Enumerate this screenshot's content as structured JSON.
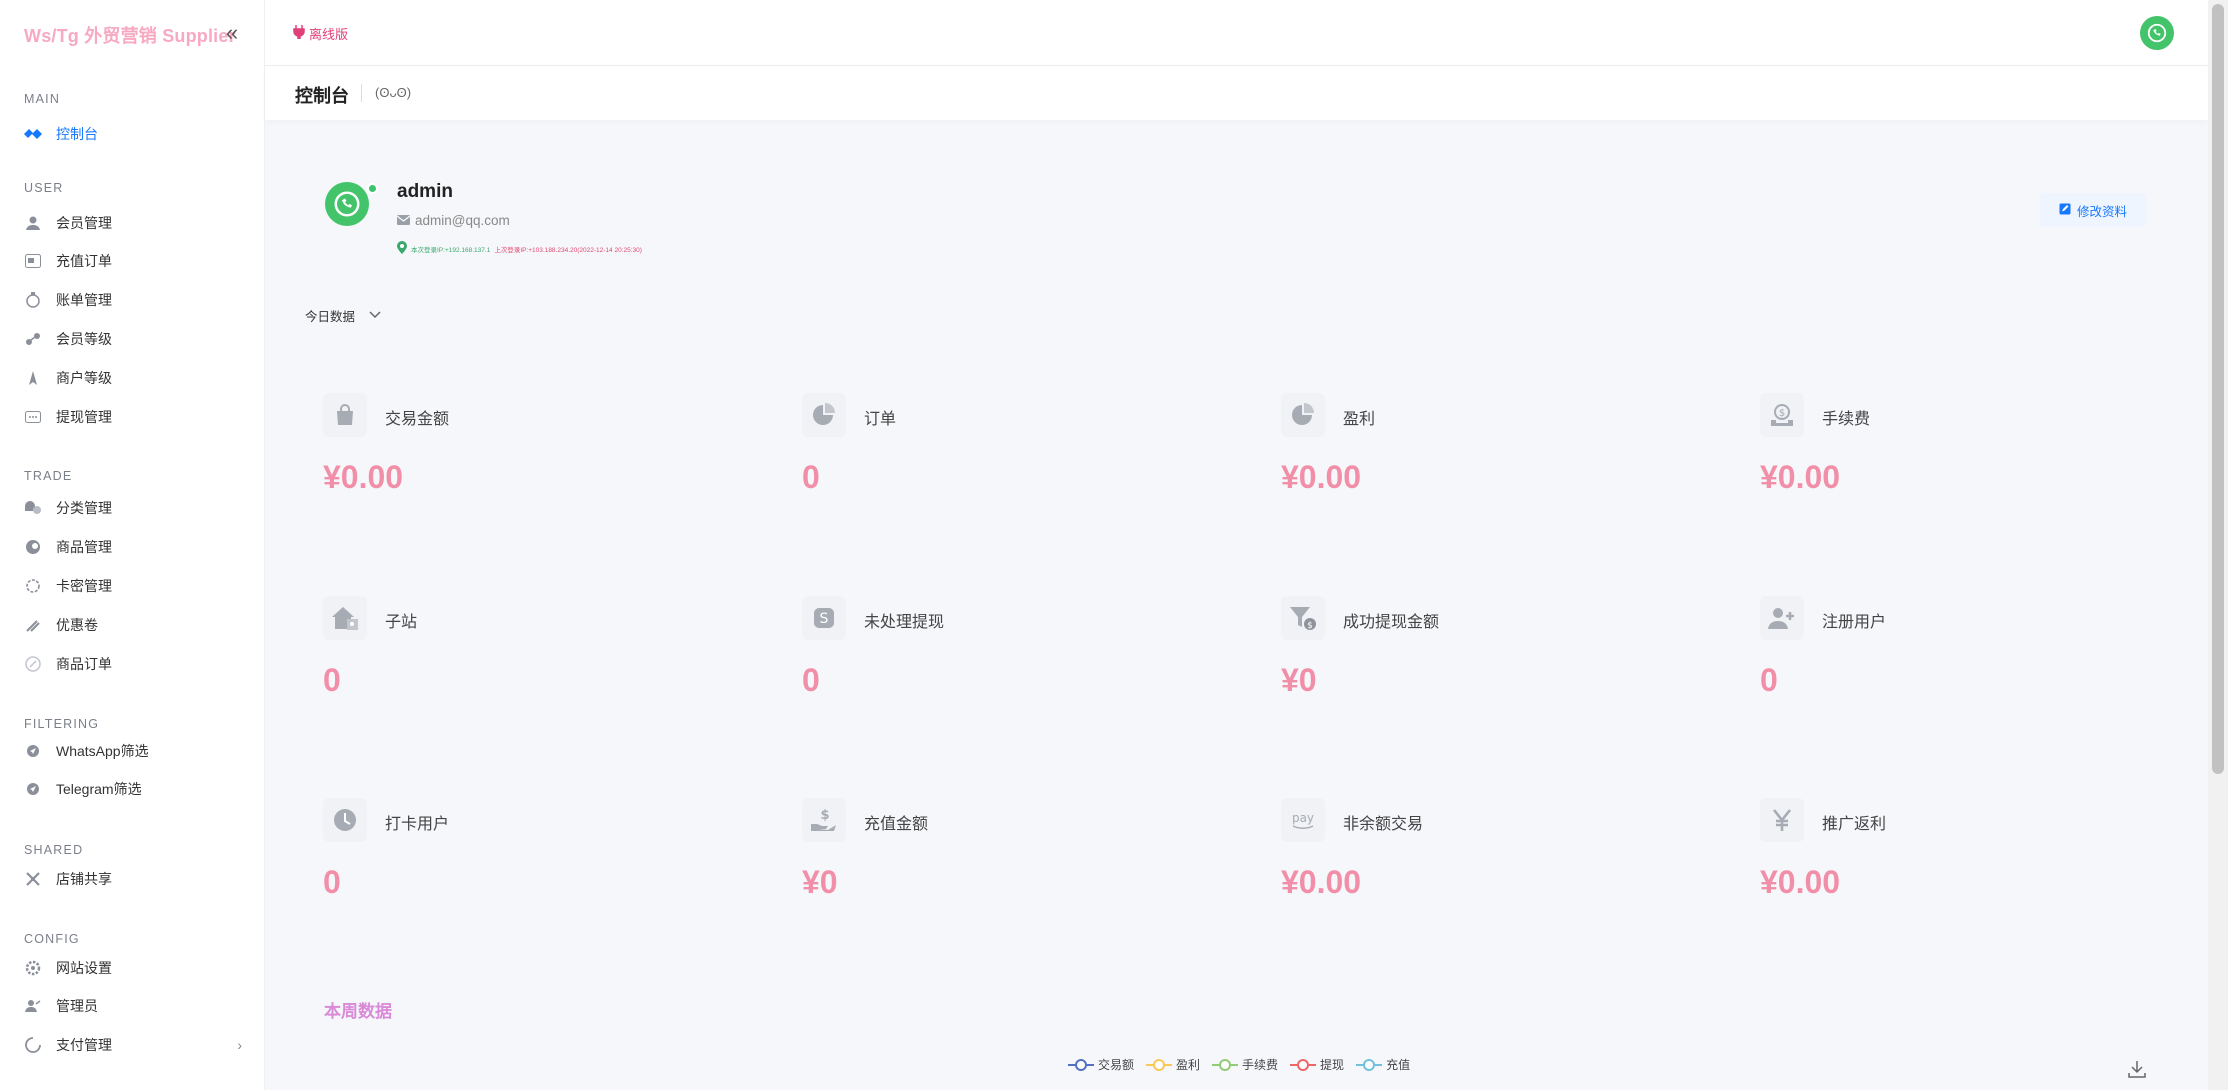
{
  "brand": {
    "title": "Ws/Tg 外贸营销 Supplier"
  },
  "sidebar": {
    "groups": [
      {
        "title": "MAIN",
        "items": [
          {
            "label": "控制台",
            "icon": "dashboard-icon",
            "active": true
          }
        ]
      },
      {
        "title": "USER",
        "items": [
          {
            "label": "会员管理",
            "icon": "user-icon"
          },
          {
            "label": "充值订单",
            "icon": "recharge-icon"
          },
          {
            "label": "账单管理",
            "icon": "bill-icon"
          },
          {
            "label": "会员等级",
            "icon": "level-icon"
          },
          {
            "label": "商户等级",
            "icon": "merchant-icon"
          },
          {
            "label": "提现管理",
            "icon": "withdraw-icon"
          }
        ]
      },
      {
        "title": "TRADE",
        "items": [
          {
            "label": "分类管理",
            "icon": "category-icon"
          },
          {
            "label": "商品管理",
            "icon": "goods-icon"
          },
          {
            "label": "卡密管理",
            "icon": "card-key-icon"
          },
          {
            "label": "优惠卷",
            "icon": "coupon-icon"
          },
          {
            "label": "商品订单",
            "icon": "order-icon"
          }
        ]
      },
      {
        "title": "FILTERING",
        "items": [
          {
            "label": "WhatsApp筛选",
            "icon": "whatsapp-icon"
          },
          {
            "label": "Telegram筛选",
            "icon": "telegram-icon"
          }
        ]
      },
      {
        "title": "SHARED",
        "items": [
          {
            "label": "店铺共享",
            "icon": "share-icon"
          }
        ]
      },
      {
        "title": "CONFIG",
        "items": [
          {
            "label": "网站设置",
            "icon": "settings-icon"
          },
          {
            "label": "管理员",
            "icon": "admin-icon"
          },
          {
            "label": "支付管理",
            "icon": "payment-icon",
            "has_children": true
          }
        ]
      }
    ]
  },
  "header": {
    "offline_label": "离线版"
  },
  "page": {
    "title": "控制台",
    "emote": "(ʘᴗʘ)"
  },
  "profile": {
    "name": "admin",
    "email": "admin@qq.com",
    "ip_prefix": "本次登录IP",
    "current_ip": "本次登录IP:+192.168.137.1",
    "last_ip": "上次登录IP:+103.188.234.20(2022-12-14 20:25:30)",
    "edit_label": "修改资料"
  },
  "today": {
    "label": "今日数据"
  },
  "stats": [
    {
      "label": "交易金额",
      "value": "¥0.00",
      "icon": "shopping-bag-icon"
    },
    {
      "label": "订单",
      "value": "0",
      "icon": "pie-chart-icon"
    },
    {
      "label": "盈利",
      "value": "¥0.00",
      "icon": "pie-chart-icon"
    },
    {
      "label": "手续费",
      "value": "¥0.00",
      "icon": "money-tray-icon"
    },
    {
      "label": "子站",
      "value": "0",
      "icon": "home-building-icon"
    },
    {
      "label": "未处理提现",
      "value": "0",
      "icon": "dollar-badge-icon"
    },
    {
      "label": "成功提现金额",
      "value": "¥0",
      "icon": "funnel-dollar-icon"
    },
    {
      "label": "注册用户",
      "value": "0",
      "icon": "user-plus-icon"
    },
    {
      "label": "打卡用户",
      "value": "0",
      "icon": "clock-icon"
    },
    {
      "label": "充值金额",
      "value": "¥0",
      "icon": "hand-dollar-icon"
    },
    {
      "label": "非余额交易",
      "value": "¥0.00",
      "icon": "pay-icon"
    },
    {
      "label": "推广返利",
      "value": "¥0.00",
      "icon": "yen-icon"
    }
  ],
  "weekly": {
    "title": "本周数据",
    "legend": [
      {
        "name": "交易额",
        "color": "#5470c6"
      },
      {
        "name": "盈利",
        "color": "#fac858"
      },
      {
        "name": "手续费",
        "color": "#91cc75"
      },
      {
        "name": "提现",
        "color": "#ee6666"
      },
      {
        "name": "充值",
        "color": "#73c0de"
      }
    ]
  }
}
